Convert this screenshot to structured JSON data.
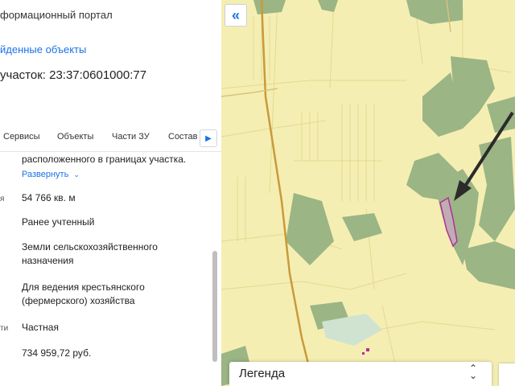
{
  "header": {
    "portal_title": "формационный портал",
    "found_objects_link": "йденные объекты",
    "parcel_title": "участок: 23:37:0601000:77"
  },
  "tabs": [
    {
      "label": "Сервисы"
    },
    {
      "label": "Объекты"
    },
    {
      "label": "Части ЗУ"
    },
    {
      "label": "Состав"
    }
  ],
  "details": {
    "location_tail": "расположенного в границах участка.",
    "expand_label": "Развернуть",
    "rows": [
      {
        "label": "я",
        "value": "54 766 кв. м"
      },
      {
        "label": "",
        "value": "Ранее учтенный"
      },
      {
        "label": "",
        "value": "Земли сельскохозяйственного назначения"
      },
      {
        "label": "",
        "value": "Для ведения крестьянского (фермерского) хозяйства"
      },
      {
        "label": "ти",
        "value": "Частная"
      },
      {
        "label": "",
        "value": "734 959,72 руб."
      }
    ]
  },
  "map": {
    "legend_label": "Легенда",
    "collapse_icon": "double-chevron-left-icon",
    "colors": {
      "fields": "#f5eeb3",
      "forest": "#9bb585",
      "parcel_outline": "#b0309a",
      "road": "#c99a3a",
      "arrow": "#2b2b2b"
    }
  }
}
